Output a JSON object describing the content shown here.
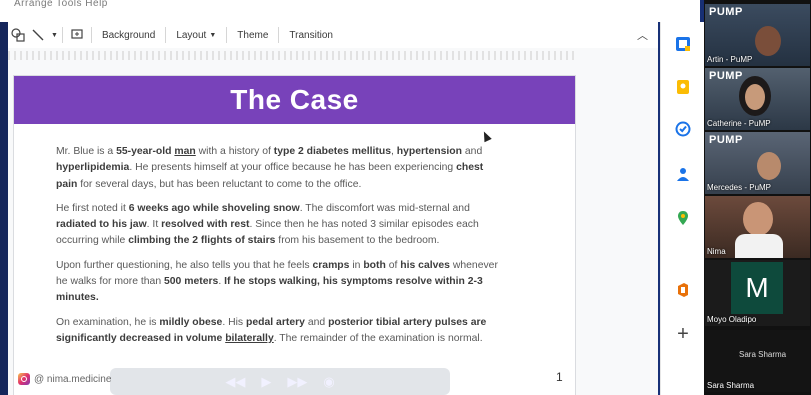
{
  "window": {
    "faded_menu": "Arrange  Tools  Help"
  },
  "toolbar": {
    "background_label": "Background",
    "layout_label": "Layout",
    "theme_label": "Theme",
    "transition_label": "Transition"
  },
  "slide": {
    "title": "The Case",
    "paragraphs": [
      "Mr. Blue is a 55-year-old man with a history of type 2 diabetes mellitus, hypertension and hyperlipidemia. He presents himself at your office because he has been experiencing chest pain for several days, but has been reluctant to come to the office.",
      "He first noted it 6 weeks ago while shoveling snow. The discomfort was mid-sternal and radiated to his jaw. It resolved with rest. Since then he has noted 3 similar episodes each occurring while climbing the 2 flights of stairs from his basement to the bedroom.",
      "Upon further questioning, he also tells you that he feels cramps in both of his calves whenever he walks for more than 500 meters. If he stops walking, his symptoms resolve within 2-3 minutes.",
      "On examination, he is mildly obese. His pedal artery and posterior tibial artery pulses are significantly decreased in volume bilaterally. The remainder of the examination is normal."
    ],
    "page_number": "1"
  },
  "watermark": {
    "handle": "@ nima.medicine"
  },
  "side_panel": {
    "icons": [
      "calendar-icon",
      "keep-icon",
      "tasks-icon",
      "contacts-icon",
      "maps-icon",
      "office-icon",
      "add-icon"
    ],
    "add_label": "+"
  },
  "participants": [
    {
      "name": "Artin - PuMP",
      "logo": "PUMP"
    },
    {
      "name": "Catherine - PuMP",
      "logo": "PUMP"
    },
    {
      "name": "Mercedes - PuMP",
      "logo": "PUMP"
    },
    {
      "name": "Nima",
      "logo": ""
    },
    {
      "name": "Moyo Oladipo",
      "initial": "M"
    },
    {
      "name": "Sara Sharma",
      "label": "Sara Sharma"
    }
  ]
}
